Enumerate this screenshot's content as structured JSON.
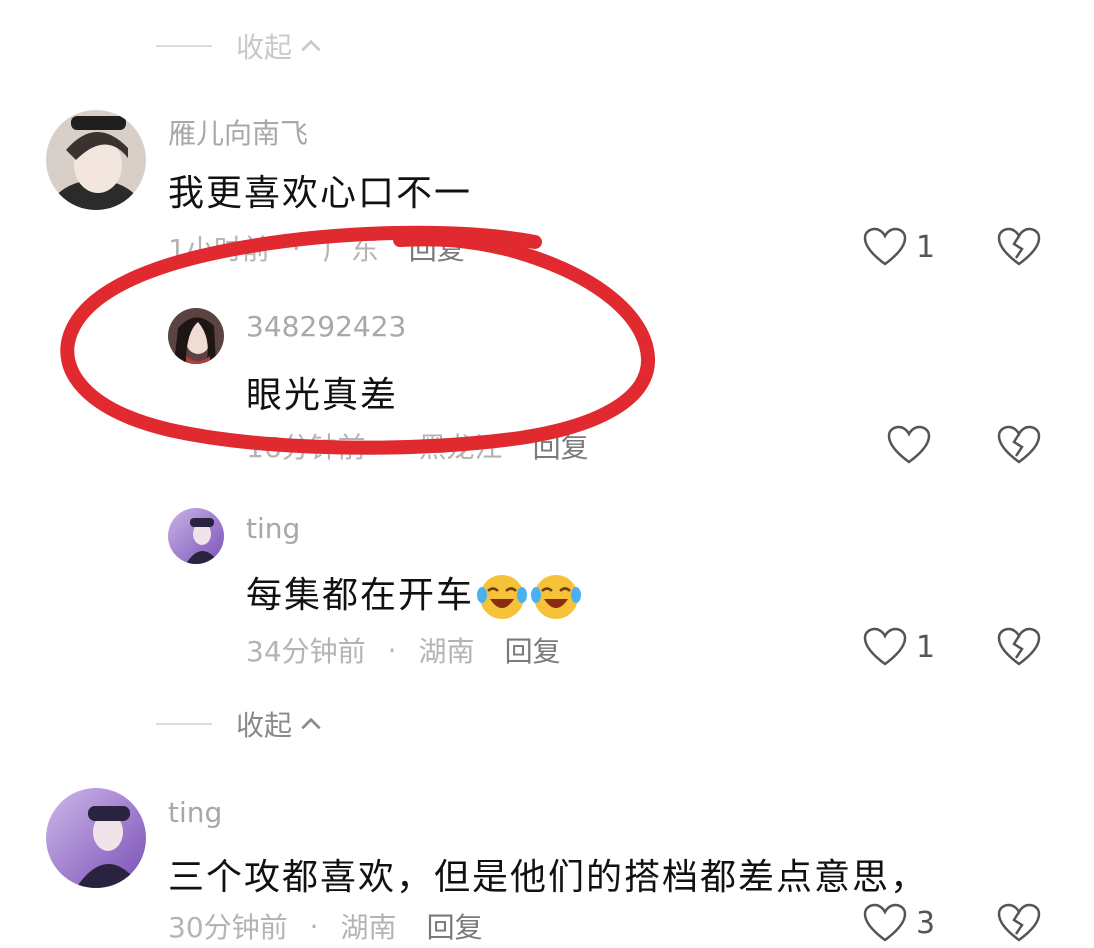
{
  "top_collapse": {
    "label": "收起"
  },
  "comments": [
    {
      "username": "雁儿向南飞",
      "text": "我更喜欢心口不一",
      "time": "1小时前",
      "location": "广东",
      "reply_label": "回复",
      "likes": "1"
    },
    {
      "username": "348292423",
      "text": "眼光真差",
      "time": "16分钟前",
      "location": "黑龙江",
      "reply_label": "回复",
      "likes": ""
    },
    {
      "username": "ting",
      "text": "每集都在开车",
      "time": "34分钟前",
      "location": "湖南",
      "reply_label": "回复",
      "likes": "1"
    },
    {
      "username": "ting",
      "text": "三个攻都喜欢，但是他们的搭档都差点意思，",
      "time": "30分钟前",
      "location": "湖南",
      "reply_label": "回复",
      "likes": "3"
    }
  ],
  "mid_collapse": {
    "label": "收起"
  },
  "annotation": {
    "color": "#e02a2f"
  },
  "icons": {
    "like": "heart-outline-icon",
    "dislike": "broken-heart-icon",
    "collapse": "chevron-up-icon",
    "emoji": "laughing-crying-emoji-icon"
  }
}
